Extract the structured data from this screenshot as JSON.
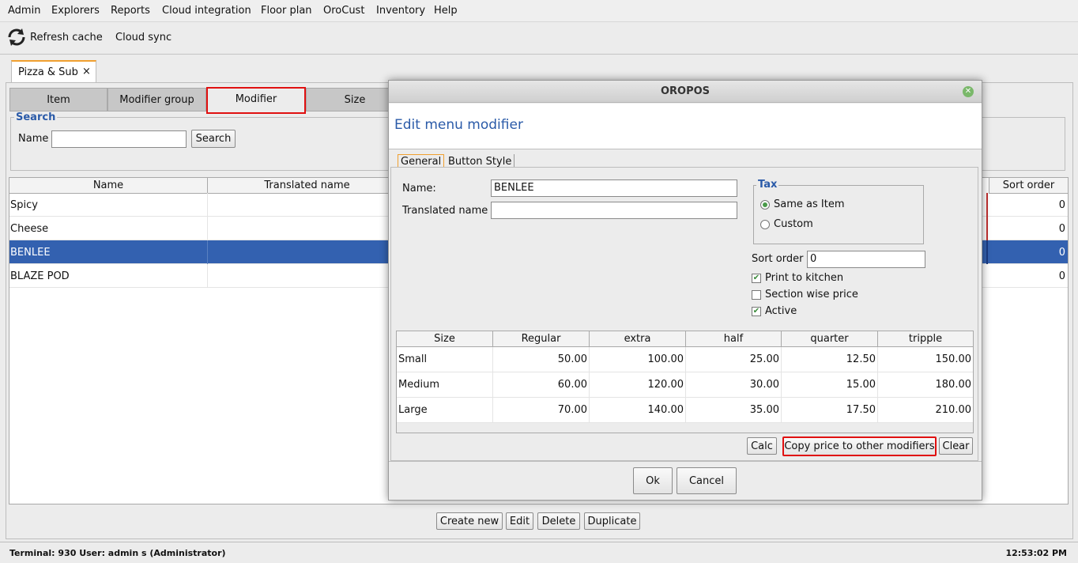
{
  "menu": [
    "Admin",
    "Explorers",
    "Reports",
    "Cloud integration",
    "Floor plan",
    "OroCust",
    "Inventory",
    "Help"
  ],
  "toolbar": {
    "refresh_label": "Refresh cache",
    "cloud_label": "Cloud sync"
  },
  "doc_tab": {
    "label": "Pizza & Sub",
    "close": "×"
  },
  "tabs": [
    "Item",
    "Modifier group",
    "Modifier",
    "Size"
  ],
  "search": {
    "legend": "Search",
    "name_label": "Name",
    "name_value": "",
    "button": "Search"
  },
  "table": {
    "columns": [
      "Name",
      "Translated name",
      "Sort order"
    ],
    "rows": [
      {
        "name": "Spicy",
        "translated": "",
        "sort": "0"
      },
      {
        "name": "Cheese",
        "translated": "",
        "sort": "0"
      },
      {
        "name": "BENLEE",
        "translated": "",
        "sort": "0"
      },
      {
        "name": "BLAZE POD",
        "translated": "",
        "sort": "0"
      }
    ]
  },
  "actions": [
    "Create new",
    "Edit",
    "Delete",
    "Duplicate"
  ],
  "status": {
    "left": "Terminal: 930 User: admin s (Administrator)",
    "right": "12:53:02 PM"
  },
  "dialog": {
    "title": "OROPOS",
    "heading": "Edit menu modifier",
    "tabs": [
      "General",
      "Button Style"
    ],
    "name_label": "Name:",
    "name_value": "BENLEE",
    "translated_label": "Translated name",
    "translated_value": "",
    "tax": {
      "legend": "Tax",
      "option1": "Same as Item",
      "option2": "Custom"
    },
    "sort_label": "Sort order",
    "sort_value": "0",
    "print_kitchen": "Print to kitchen",
    "section_wise": "Section wise price",
    "active": "Active",
    "price_table": {
      "columns": [
        "Size",
        "Regular",
        "extra",
        "half",
        "quarter",
        "tripple"
      ],
      "rows": [
        [
          "Small",
          "50.00",
          "100.00",
          "25.00",
          "12.50",
          "150.00"
        ],
        [
          "Medium",
          "60.00",
          "120.00",
          "30.00",
          "15.00",
          "180.00"
        ],
        [
          "Large",
          "70.00",
          "140.00",
          "35.00",
          "17.50",
          "210.00"
        ]
      ]
    },
    "calc": "Calc",
    "copy": "Copy price to other modifiers",
    "clear": "Clear",
    "ok": "Ok",
    "cancel": "Cancel"
  }
}
